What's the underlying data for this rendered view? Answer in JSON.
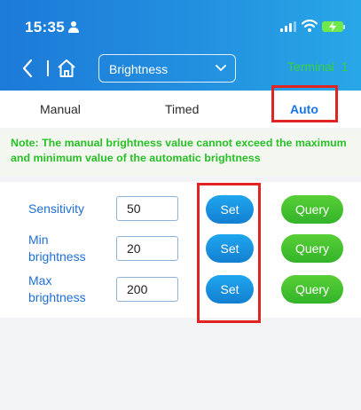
{
  "status_bar": {
    "time": "15:35",
    "icons": [
      "person-icon",
      "signal-icon",
      "wifi-icon",
      "battery-charging-icon"
    ]
  },
  "nav": {
    "icons": [
      "back-chevron-icon",
      "home-icon",
      "chevron-down-icon"
    ],
    "selected_option": "Brightness",
    "right_label": "Terminal",
    "right_label_suffix": "1"
  },
  "tabs": [
    {
      "label": "Manual"
    },
    {
      "label": "Timed"
    },
    {
      "label": "Auto",
      "active": true
    }
  ],
  "note": "Note: The manual brightness value cannot exceed the maximum and minimum value of the automatic brightness",
  "settings": [
    {
      "label_line1": "Sensitivity",
      "label_line2": "",
      "value": "50",
      "set_label": "Set",
      "query_label": "Query"
    },
    {
      "label_line1": "Min",
      "label_line2": "brightness",
      "value": "20",
      "set_label": "Set",
      "query_label": "Query"
    },
    {
      "label_line1": "Max",
      "label_line2": "brightness",
      "value": "200",
      "set_label": "Set",
      "query_label": "Query"
    }
  ],
  "colors": {
    "header": "#1c7ad8",
    "active_tab": "#1677e6",
    "note_text": "#27c127",
    "label_blue": "#1e6fd6",
    "set_button": "#1793de",
    "query_button": "#43c030",
    "highlight_box": "#e02424"
  }
}
